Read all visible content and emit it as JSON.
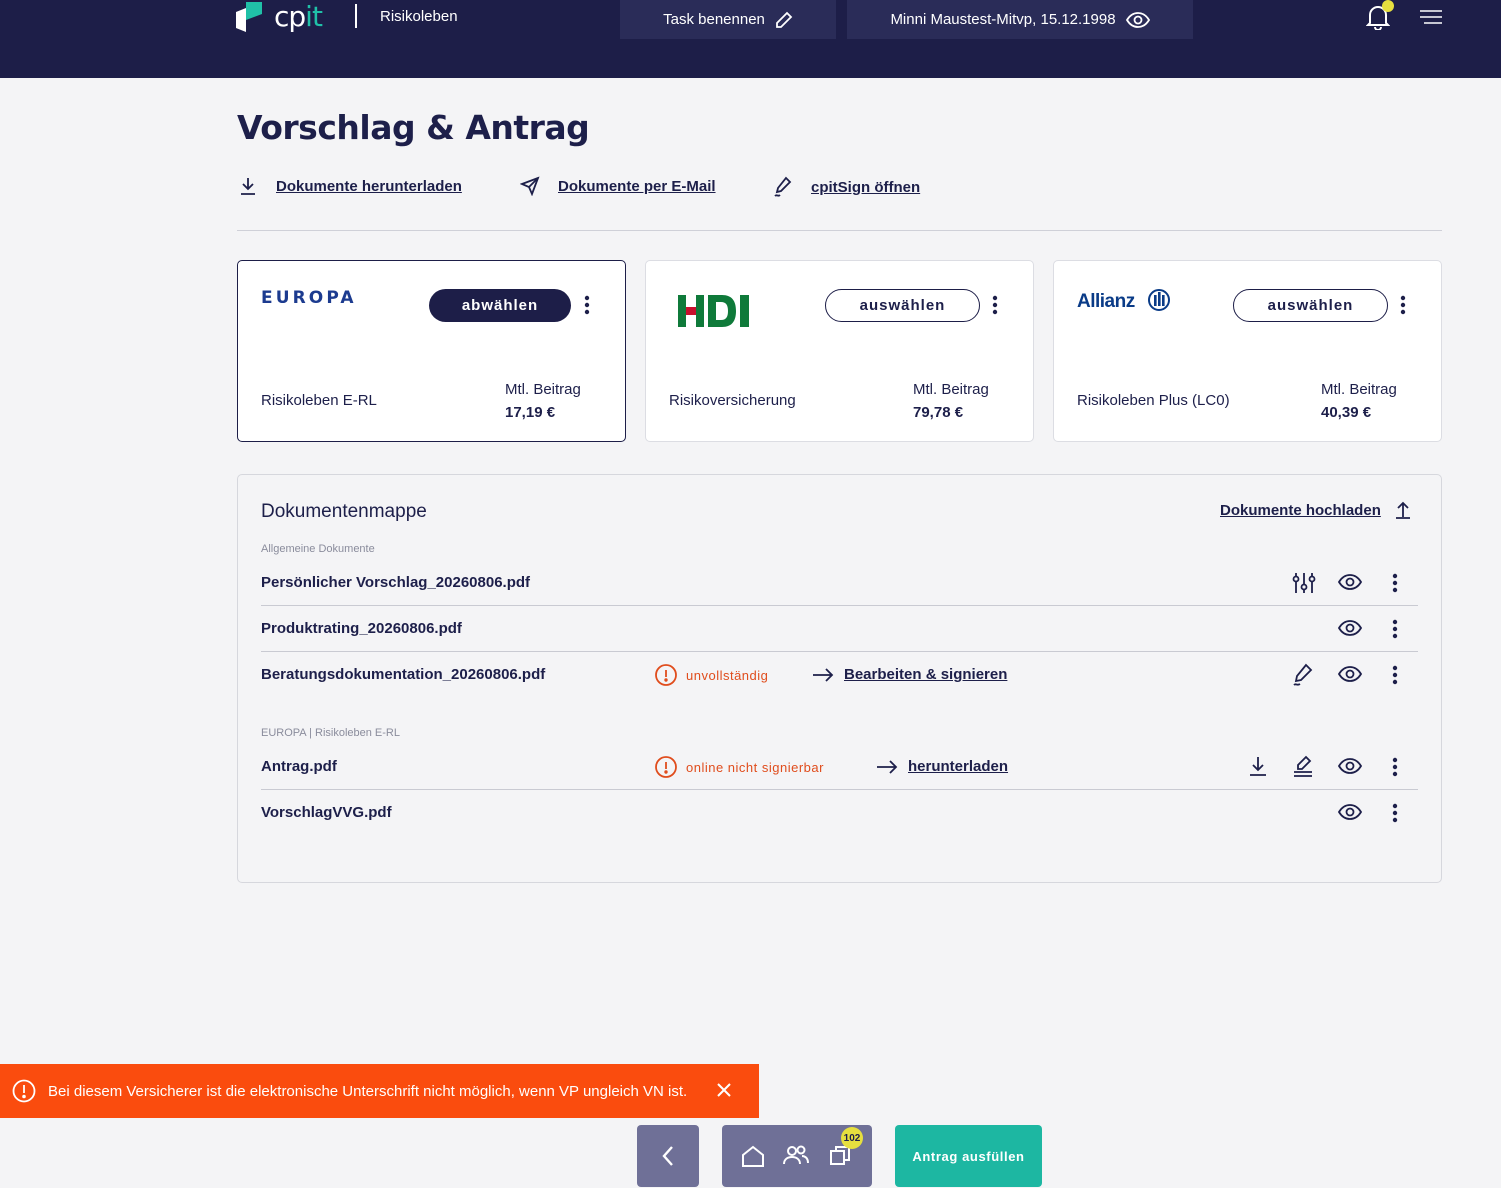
{
  "header": {
    "logo_text_a": "cp",
    "logo_text_b": "it",
    "app_name": "Risikoleben",
    "task_label": "Task benennen",
    "person_label": "Minni Maustest-Mitvp,  15.12.1998"
  },
  "page": {
    "title": "Vorschlag & Antrag"
  },
  "actions": {
    "download": "Dokumente herunterladen",
    "email": "Dokumente per E-Mail",
    "sign": "cpitSign öffnen"
  },
  "cards": [
    {
      "insurer": "EUROPA",
      "button": "abwählen",
      "selected": true,
      "product": "Risikoleben E-RL",
      "price_label": "Mtl. Beitrag",
      "price": "17,19 €"
    },
    {
      "insurer": "HDI",
      "button": "auswählen",
      "selected": false,
      "product": "Risikoversicherung",
      "price_label": "Mtl. Beitrag",
      "price": "79,78 €"
    },
    {
      "insurer": "Allianz",
      "button": "auswählen",
      "selected": false,
      "product": "Risikoleben Plus (LC0)",
      "price_label": "Mtl. Beitrag",
      "price": "40,39 €"
    }
  ],
  "documents": {
    "title": "Dokumentenmappe",
    "upload": "Dokumente hochladen",
    "section_general": "Allgemeine Dokumente",
    "section_europa": "EUROPA | Risikoleben E-RL",
    "rows": [
      {
        "name": "Persönlicher Vorschlag_20260806.pdf"
      },
      {
        "name": "Produktrating_20260806.pdf"
      },
      {
        "name": "Beratungsdokumentation_20260806.pdf",
        "status": "unvollständig",
        "link": "Bearbeiten & signieren"
      },
      {
        "name": "Antrag.pdf",
        "status": "online nicht signierbar",
        "link": "herunterladen"
      },
      {
        "name": "VorschlagVVG.pdf"
      }
    ]
  },
  "toast": {
    "message": "Bei diesem Versicherer ist die elektronische Unterschrift nicht möglich, wenn VP ungleich VN ist."
  },
  "bottom": {
    "badge_count": "102",
    "fill_button": "Antrag ausfüllen"
  },
  "colors": {
    "navy": "#1d1e48",
    "teal": "#1db7a2",
    "alert": "#fa4c0e",
    "badge": "#e6df3f"
  }
}
